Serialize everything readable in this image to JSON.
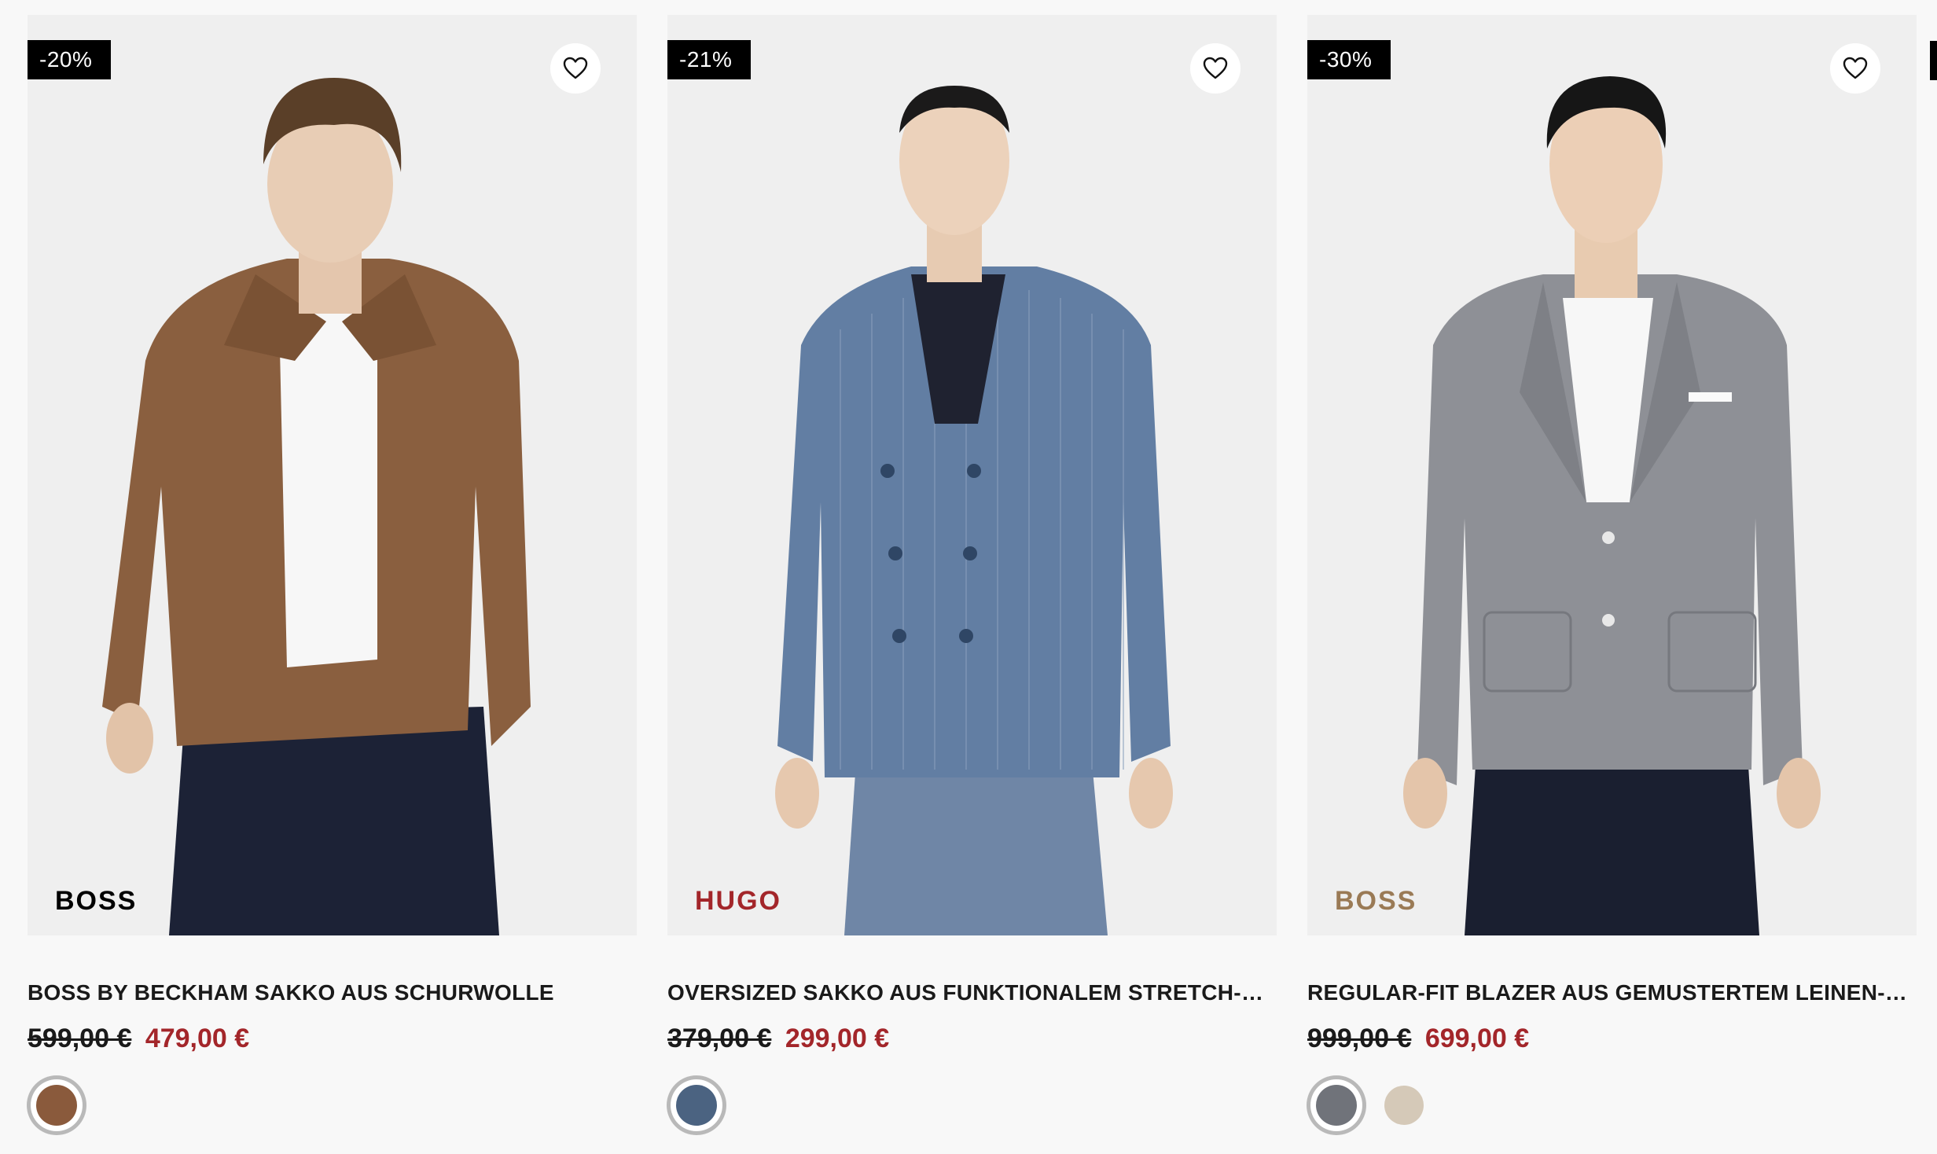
{
  "products": [
    {
      "badge": "-20%",
      "brand": "BOSS",
      "brand_color": "#000000",
      "title": "BOSS BY BECKHAM SAKKO AUS SCHURWOLLE",
      "old_price": "599,00 €",
      "new_price": "479,00 €",
      "wishlist_icon": "heart-outline-icon",
      "swatches": [
        {
          "color": "#8a5a3c",
          "selected": true
        }
      ]
    },
    {
      "badge": "-21%",
      "brand": "HUGO",
      "brand_color": "#a3262a",
      "title": "OVERSIZED SAKKO AUS FUNKTIONALEM STRETCH-GE...",
      "old_price": "379,00 €",
      "new_price": "299,00 €",
      "wishlist_icon": "heart-outline-icon",
      "swatches": [
        {
          "color": "#4b6381",
          "selected": true
        }
      ]
    },
    {
      "badge": "-30%",
      "brand": "BOSS",
      "brand_color": "#9a7a55",
      "title": "REGULAR-FIT BLAZER AUS GEMUSTERTEM LEINEN-MIX",
      "old_price": "999,00 €",
      "new_price": "699,00 €",
      "wishlist_icon": "heart-outline-icon",
      "swatches": [
        {
          "color": "#70737a",
          "selected": true
        },
        {
          "color": "#d5c9b8",
          "selected": false
        }
      ]
    }
  ]
}
